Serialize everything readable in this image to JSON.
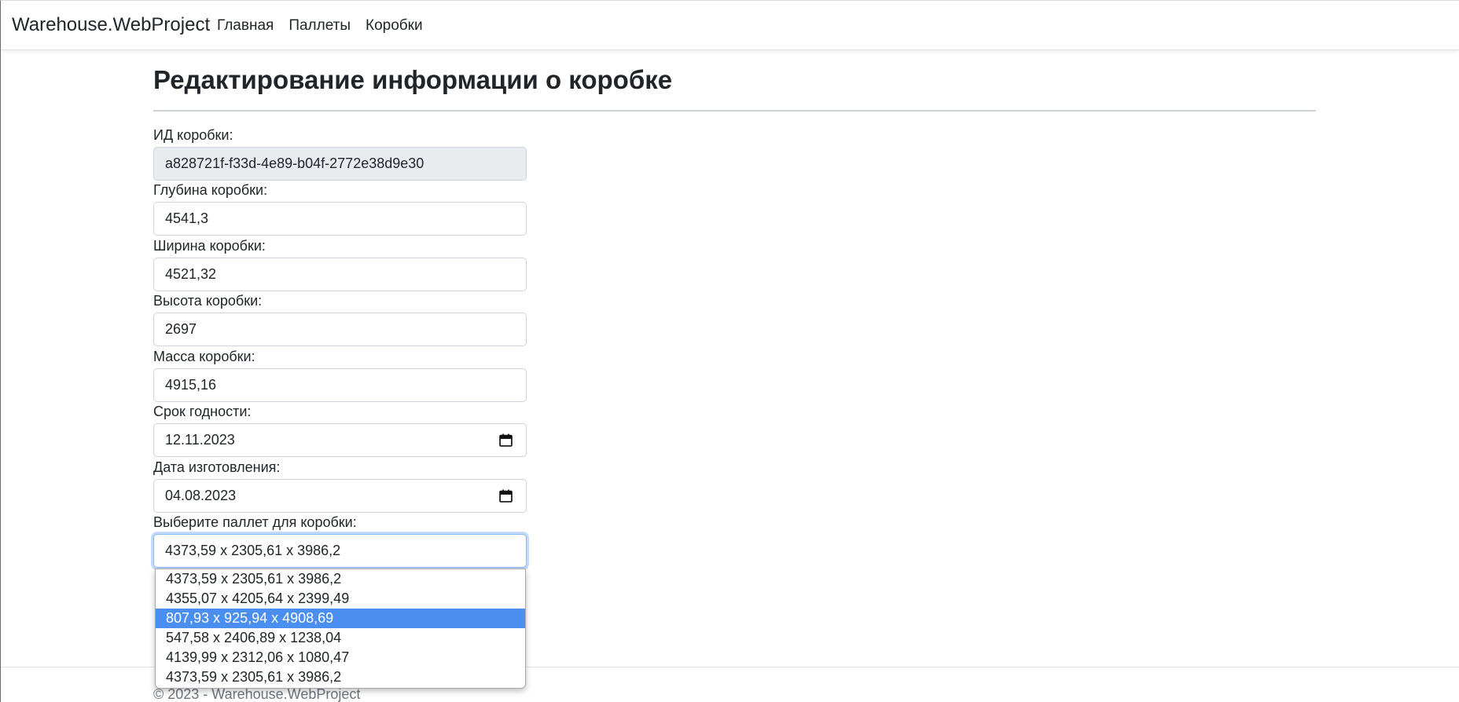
{
  "navbar": {
    "brand": "Warehouse.WebProject",
    "links": [
      "Главная",
      "Паллеты",
      "Коробки"
    ]
  },
  "page": {
    "title": "Редактирование информации о коробке"
  },
  "form": {
    "id": {
      "label": "ИД коробки:",
      "value": "a828721f-f33d-4e89-b04f-2772e38d9e30"
    },
    "depth": {
      "label": "Глубина коробки:",
      "value": "4541,3"
    },
    "width": {
      "label": "Ширина коробки:",
      "value": "4521,32"
    },
    "height": {
      "label": "Высота коробки:",
      "value": "2697"
    },
    "mass": {
      "label": "Масса коробки:",
      "value": "4915,16"
    },
    "expiry": {
      "label": "Срок годности:",
      "value": "12.11.2023"
    },
    "manufactured": {
      "label": "Дата изготовления:",
      "value": "04.08.2023"
    },
    "pallet": {
      "label": "Выберите паллет для коробки:",
      "value": "4373,59 x 2305,61 x 3986,2",
      "options": [
        "4373,59 x 2305,61 x 3986,2",
        "4355,07 x 4205,64 x 2399,49",
        "807,93 x 925,94 x 4908,69",
        "547,58 x 2406,89 x 1238,04",
        "4139,99 x 2312,06 x 1080,47",
        "4373,59 x 2305,61 x 3986,2"
      ],
      "highlighted_index": 2
    }
  },
  "footer": {
    "text": "© 2023 - Warehouse.WebProject"
  },
  "colors": {
    "highlight": "#4a8ff0",
    "readonly_bg": "#e9ecef",
    "focus_border": "#86b7fe"
  },
  "icons": {
    "date_picker": "calendar-icon"
  }
}
